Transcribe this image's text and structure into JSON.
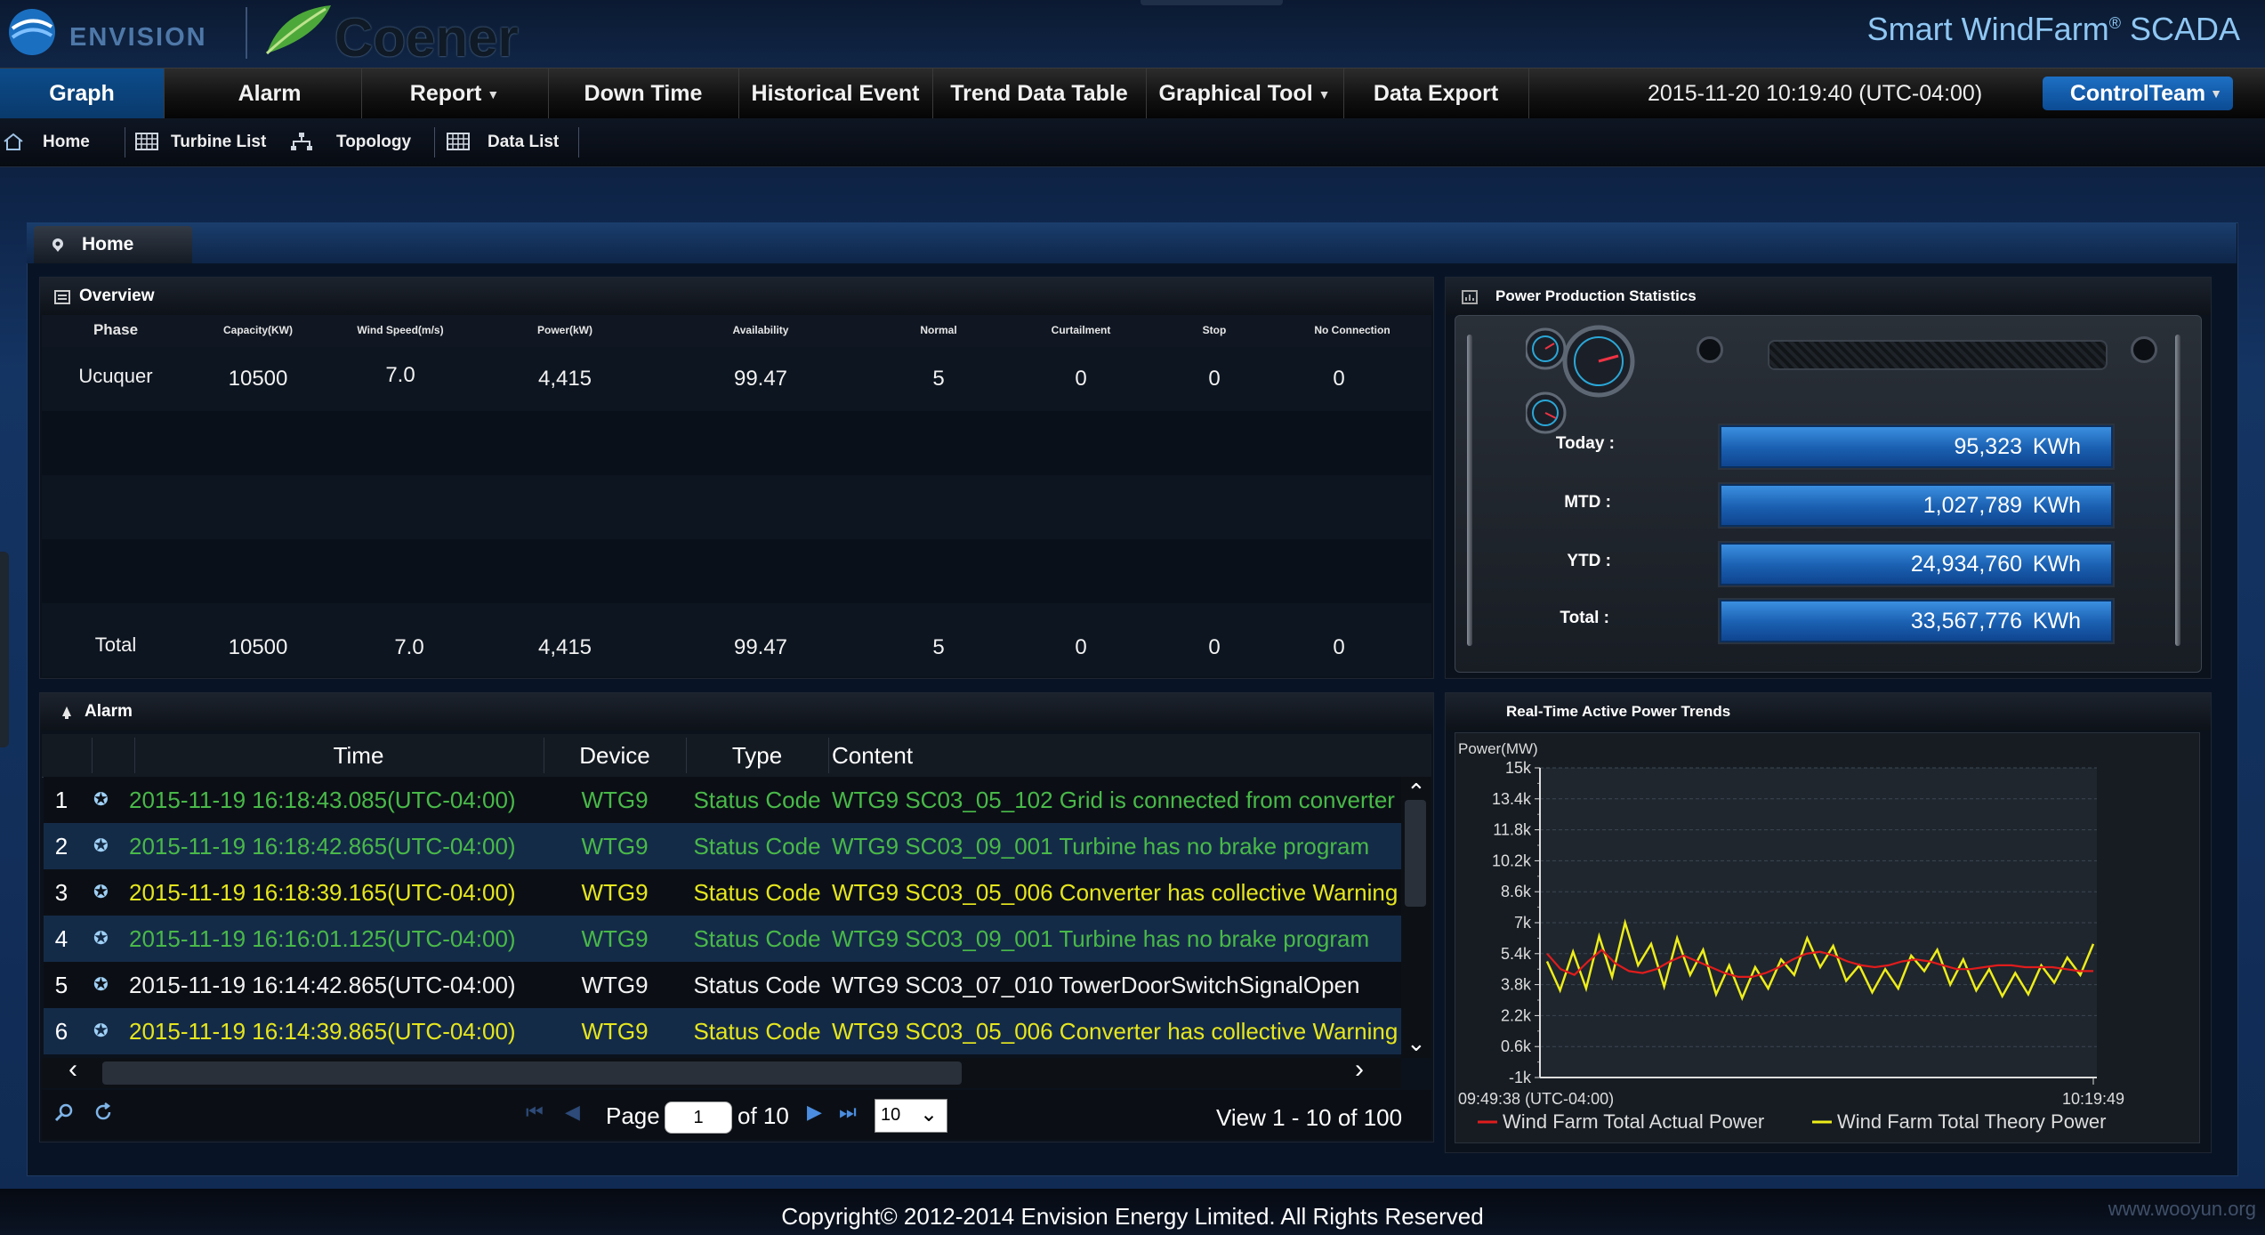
{
  "header": {
    "brand": "ENVISION",
    "partner": "Coener",
    "app_title": "Smart WindFarm",
    "app_title_mark": "®",
    "app_title_suffix": " SCADA"
  },
  "menu": {
    "items": [
      "Graph",
      "Alarm",
      "Report",
      "Down Time",
      "Historical Event",
      "Trend Data Table",
      "Graphical Tool",
      "Data Export"
    ],
    "datetime": "2015-11-20 10:19:40 (UTC-04:00)",
    "user": "ControlTeam"
  },
  "subnav": {
    "home": "Home",
    "turbine_list": "Turbine List",
    "topology": "Topology",
    "data_list": "Data List"
  },
  "page": {
    "tab": "Home"
  },
  "overview": {
    "title": "Overview",
    "columns": [
      "Phase",
      "Capacity(KW)",
      "Wind Speed(m/s)",
      "Power(kW)",
      "Availability",
      "Normal",
      "Curtailment",
      "Stop",
      "No Connection"
    ],
    "row": [
      "Ucuquer",
      "10500",
      "7.0",
      "4,415",
      "99.47",
      "5",
      "0",
      "0",
      "0"
    ],
    "total": [
      "Total",
      "10500",
      "7.0",
      "4,415",
      "99.47",
      "5",
      "0",
      "0",
      "0"
    ]
  },
  "power_stats": {
    "title": "Power Production Statistics",
    "today_label": "Today :",
    "today_value": "95,323",
    "mtd_label": "MTD :",
    "mtd_value": "1,027,789",
    "ytd_label": "YTD :",
    "ytd_value": "24,934,760",
    "total_label": "Total :",
    "total_value": "33,567,776",
    "unit": "KWh"
  },
  "alarm": {
    "title": "Alarm",
    "columns": {
      "time": "Time",
      "device": "Device",
      "type": "Type",
      "content": "Content"
    },
    "rows": [
      {
        "n": "1",
        "time": "2015-11-19 16:18:43.085(UTC-04:00)",
        "device": "WTG9",
        "type": "Status Code",
        "content": "WTG9 SC03_05_102 Grid is connected from converter",
        "color": "#49b949"
      },
      {
        "n": "2",
        "time": "2015-11-19 16:18:42.865(UTC-04:00)",
        "device": "WTG9",
        "type": "Status Code",
        "content": "WTG9 SC03_09_001 Turbine has no brake program",
        "color": "#49b949"
      },
      {
        "n": "3",
        "time": "2015-11-19 16:18:39.165(UTC-04:00)",
        "device": "WTG9",
        "type": "Status Code",
        "content": "WTG9 SC03_05_006 Converter has collective Warning",
        "color": "#e6e61e"
      },
      {
        "n": "4",
        "time": "2015-11-19 16:16:01.125(UTC-04:00)",
        "device": "WTG9",
        "type": "Status Code",
        "content": "WTG9 SC03_09_001 Turbine has no brake program",
        "color": "#49b949"
      },
      {
        "n": "5",
        "time": "2015-11-19 16:14:42.865(UTC-04:00)",
        "device": "WTG9",
        "type": "Status Code",
        "content": "WTG9 SC03_07_010 TowerDoorSwitchSignalOpen",
        "color": "#f2f2f2"
      },
      {
        "n": "6",
        "time": "2015-11-19 16:14:39.865(UTC-04:00)",
        "device": "WTG9",
        "type": "Status Code",
        "content": "WTG9 SC03_05_006 Converter has collective Warning",
        "color": "#e6e61e"
      }
    ],
    "pager": {
      "page_label": "Page",
      "page": "1",
      "of_label": "of 10",
      "page_size": "10",
      "view": "View 1 - 10 of 100"
    }
  },
  "chart_data": {
    "type": "line",
    "title": "Real-Time Active Power Trends",
    "ylabel": "Power(MW)",
    "yticks": [
      "15k",
      "13.4k",
      "11.8k",
      "10.2k",
      "8.6k",
      "7k",
      "5.4k",
      "3.8k",
      "2.2k",
      "0.6k",
      "-1k"
    ],
    "ylim": [
      -1000,
      15000
    ],
    "x_start": "09:49:38 (UTC-04:00)",
    "x_end": "10:19:49",
    "grid": true,
    "legend_position": "bottom",
    "series": [
      {
        "name": "Wind Farm Total Actual Power",
        "color": "#e01c1c",
        "values": [
          5400,
          4600,
          4300,
          5000,
          5600,
          4900,
          4500,
          4400,
          4600,
          5000,
          5300,
          5000,
          4700,
          4400,
          4200,
          4200,
          4400,
          4700,
          5100,
          5400,
          5500,
          5300,
          5000,
          4800,
          4700,
          4800,
          5000,
          5100,
          5000,
          4800,
          4600,
          4600,
          4700,
          4800,
          4800,
          4700,
          4700,
          4700,
          4600,
          4500,
          4500
        ]
      },
      {
        "name": "Wind Farm Total Theory Power",
        "color": "#eded1a",
        "values": [
          5000,
          3500,
          5500,
          3600,
          6300,
          4200,
          7000,
          4800,
          5900,
          3700,
          6200,
          4300,
          5600,
          3300,
          4800,
          3100,
          4700,
          3600,
          5100,
          4300,
          6200,
          4700,
          5800,
          4000,
          4800,
          3400,
          4600,
          3600,
          5300,
          4500,
          5600,
          3800,
          5100,
          3500,
          4600,
          3200,
          4400,
          3300,
          4800,
          3900,
          5200,
          4300,
          5900
        ]
      }
    ]
  },
  "footer": {
    "copyright": "Copyright© 2012-2014 Envision Energy Limited. All Rights Reserved",
    "watermark": "www.wooyun.org"
  }
}
